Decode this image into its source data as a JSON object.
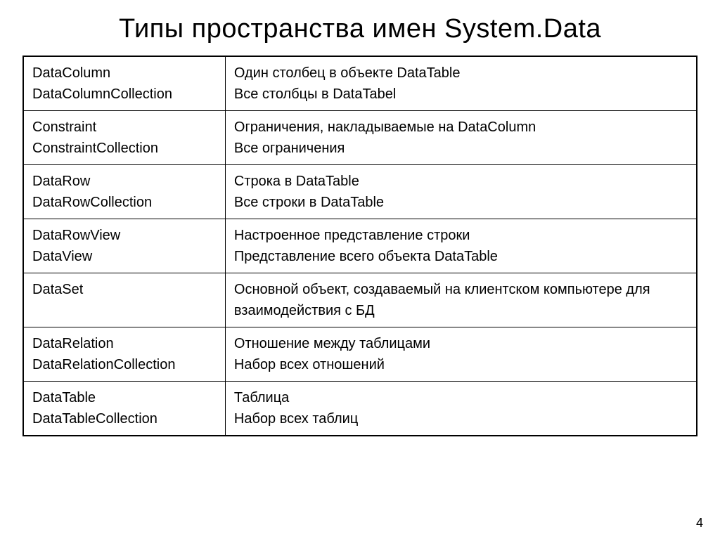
{
  "title": "Типы пространства имен System.Data",
  "page_number": "4",
  "rows": [
    {
      "type1": "DataColumn",
      "type2": "DataColumnCollection",
      "desc1": "Один столбец в объекте DataTable",
      "desc2": "Все столбцы в DataTabel"
    },
    {
      "type1": "Constraint",
      "type2": "ConstraintCollection",
      "desc1": "Ограничения, накладываемые на DataColumn",
      "desc2": "Все ограничения"
    },
    {
      "type1": "DataRow",
      "type2": "DataRowCollection",
      "desc1": "Строка в DataTable",
      "desc2": "Все строки в DataTable"
    },
    {
      "type1": "DataRowView",
      "type2": "DataView",
      "desc1": "Настроенное представление строки",
      "desc2": "Представление всего объекта DataTable"
    },
    {
      "type1": "DataSet",
      "type2": "",
      "desc1": "Основной объект, создаваемый на клиентском компьютере для взаимодействия с БД",
      "desc2": ""
    },
    {
      "type1": "DataRelation",
      "type2": "DataRelationCollection",
      "desc1": "Отношение между таблицами",
      "desc2": "Набор всех отношений"
    },
    {
      "type1": "DataTable",
      "type2": "DataTableCollection",
      "desc1": "Таблица",
      "desc2": "Набор всех таблиц"
    }
  ]
}
